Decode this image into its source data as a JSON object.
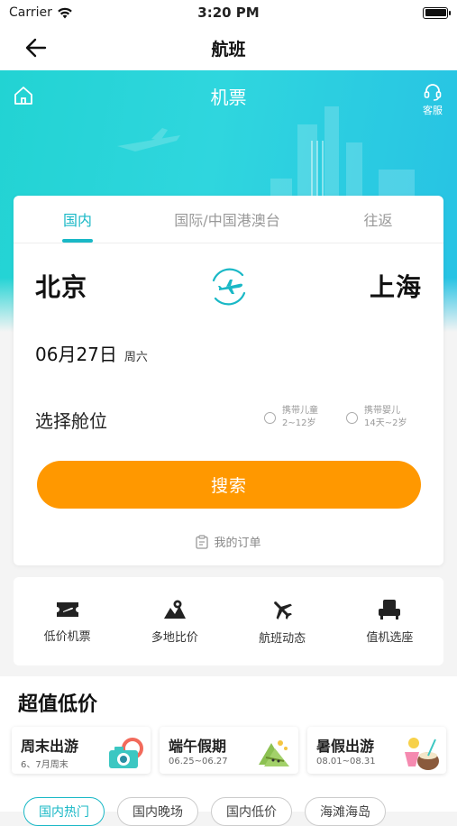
{
  "status_bar": {
    "carrier": "Carrier",
    "time": "3:20 PM"
  },
  "nav": {
    "title": "航班"
  },
  "hero": {
    "title": "机票",
    "service_label": "客服"
  },
  "tabs": [
    {
      "label": "国内",
      "active": true
    },
    {
      "label": "国际/中国港澳台",
      "active": false
    },
    {
      "label": "往返",
      "active": false
    }
  ],
  "route": {
    "from": "北京",
    "to": "上海"
  },
  "date": {
    "value": "06月27日",
    "weekday": "周六"
  },
  "cabin": {
    "label": "选择舱位",
    "child": {
      "title": "携带儿童",
      "sub": "2~12岁"
    },
    "infant": {
      "title": "携带婴儿",
      "sub": "14天~2岁"
    }
  },
  "search_label": "搜索",
  "orders_label": "我的订单",
  "services": [
    {
      "label": "低价机票",
      "icon": "ticket-icon"
    },
    {
      "label": "多地比价",
      "icon": "map-pin-icon"
    },
    {
      "label": "航班动态",
      "icon": "plane-icon"
    },
    {
      "label": "值机选座",
      "icon": "seat-icon"
    }
  ],
  "deals": {
    "heading": "超值低价",
    "cards": [
      {
        "title": "周末出游",
        "sub": "6、7月周末",
        "icon": "camera-icon"
      },
      {
        "title": "端午假期",
        "sub": "06.25~06.27",
        "icon": "zongzi-icon"
      },
      {
        "title": "暑假出游",
        "sub": "08.01~08.31",
        "icon": "drink-icon"
      }
    ],
    "chips": [
      "国内热门",
      "国内晚场",
      "国内低价",
      "海滩海岛"
    ]
  },
  "colors": {
    "accent": "#19b8c6",
    "button": "#ff9800",
    "hero_start": "#22d3d3",
    "hero_end": "#27c2e4"
  }
}
